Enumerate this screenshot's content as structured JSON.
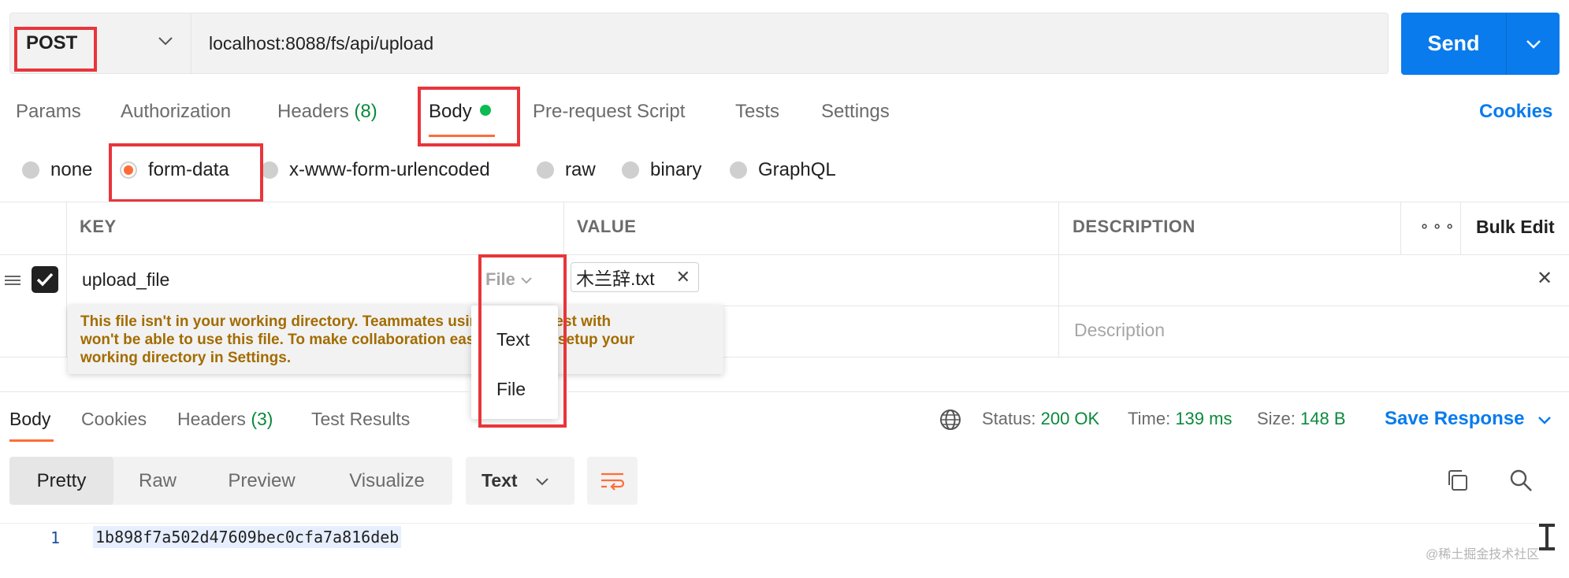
{
  "request": {
    "method": "POST",
    "url": "localhost:8088/fs/api/upload",
    "send_label": "Send"
  },
  "request_tabs": {
    "params": "Params",
    "authorization": "Authorization",
    "headers": "Headers",
    "headers_count": "(8)",
    "body": "Body",
    "prerequest": "Pre-request Script",
    "tests": "Tests",
    "settings": "Settings",
    "cookies": "Cookies"
  },
  "body_types": {
    "none": "none",
    "form_data": "form-data",
    "urlencoded": "x-www-form-urlencoded",
    "raw": "raw",
    "binary": "binary",
    "graphql": "GraphQL",
    "selected": "form-data"
  },
  "table": {
    "headers": {
      "key": "KEY",
      "value": "VALUE",
      "description": "DESCRIPTION",
      "bulk_edit": "Bulk Edit"
    },
    "row": {
      "key": "upload_file",
      "type": "File",
      "file_name": "木兰辞.txt",
      "checked": true
    },
    "description_placeholder": "Description"
  },
  "warning": {
    "line1": "This file isn't in your working directory. Teammates using this request with",
    "line2": "won't be able to use this file. To make collaboration easier you can setup your",
    "line3": "working directory in Settings."
  },
  "type_dropdown": {
    "options": [
      "Text",
      "File"
    ]
  },
  "response": {
    "tabs": {
      "body": "Body",
      "cookies": "Cookies",
      "headers": "Headers",
      "headers_count": "(3)",
      "test_results": "Test Results"
    },
    "status_label": "Status:",
    "status_value": "200 OK",
    "time_label": "Time:",
    "time_value": "139 ms",
    "size_label": "Size:",
    "size_value": "148 B",
    "save_response": "Save Response",
    "view_modes": [
      "Pretty",
      "Raw",
      "Preview",
      "Visualize"
    ],
    "selected_view": "Pretty",
    "format": "Text",
    "line_number": "1",
    "body_text": "1b898f7a502d47609bec0cfa7a816deb"
  },
  "watermark": "@稀土掘金技术社区",
  "colors": {
    "accent_blue": "#097bed",
    "accent_orange": "#ff6c37",
    "success_green": "#0a8a3c",
    "highlight_red": "#e8353b",
    "warning_text": "#a36c00"
  }
}
